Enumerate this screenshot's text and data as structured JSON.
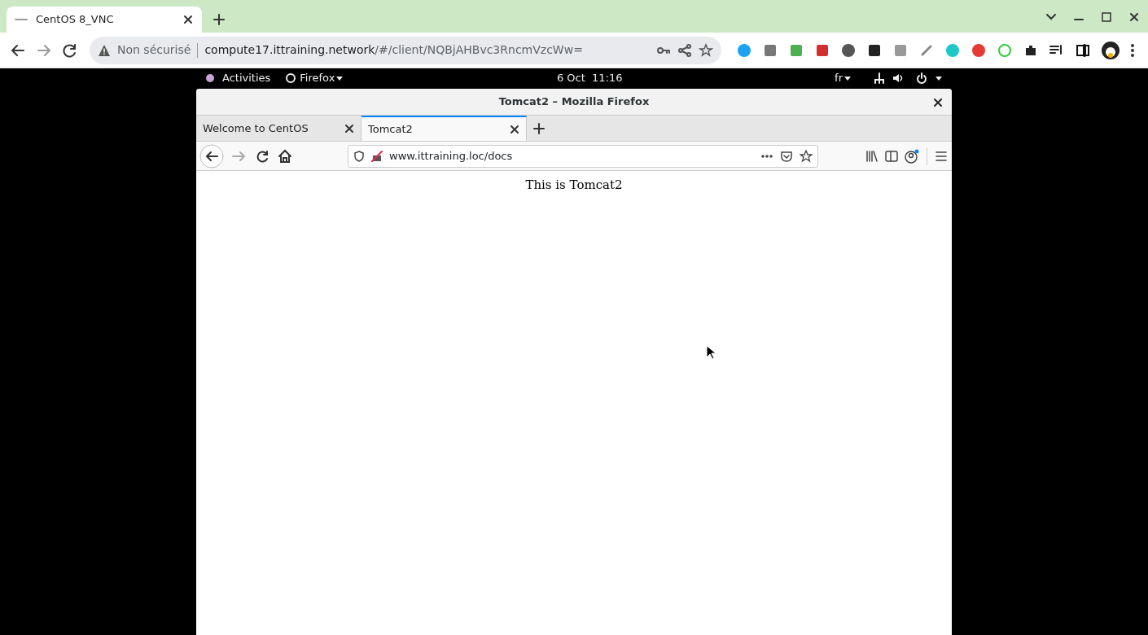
{
  "browser": {
    "tabs": [
      {
        "title": "CentOS 8_VNC",
        "selected": true
      }
    ],
    "address": {
      "security": "Non sécurisé",
      "host": "compute17.ittraining.network",
      "path": "/#/client/NQBjAHBvc3RncmVzcWw="
    }
  },
  "desktop_bar": {
    "activities": "Activities",
    "app": "Firefox",
    "date": "6 Oct",
    "time": "11:16",
    "language": "fr"
  },
  "firefox": {
    "title": "Tomcat2 – Mozilla Firefox",
    "tabs": [
      {
        "title": "Welcome to CentOS",
        "selected": false
      },
      {
        "title": "Tomcat2",
        "selected": true
      }
    ],
    "url": "www.ittraining.loc/docs"
  },
  "page": {
    "text": "This is Tomcat2"
  }
}
